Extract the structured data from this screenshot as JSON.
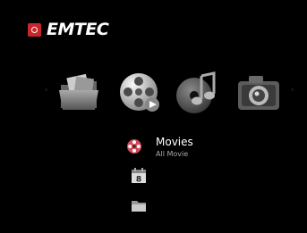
{
  "brand": {
    "name": "EMTEC",
    "icon": "emtec-logo-mark"
  },
  "menu": {
    "items": [
      {
        "id": "folder",
        "icon": "folder-icon"
      },
      {
        "id": "movie",
        "icon": "film-reel-icon"
      },
      {
        "id": "music",
        "icon": "music-disc-icon"
      },
      {
        "id": "photo",
        "icon": "camera-icon"
      }
    ],
    "selected": {
      "title": "Movies",
      "subtitle": "All Movie",
      "icon": "film-reel-small-icon"
    }
  },
  "submenu": {
    "calendar_day": "8",
    "items": [
      {
        "icon": "calendar-icon"
      },
      {
        "icon": "folder-small-icon"
      }
    ]
  },
  "colors": {
    "background": "#000000",
    "brand_red": "#c8262c",
    "text": "#ffffff",
    "subtext": "#aaaaaa"
  }
}
